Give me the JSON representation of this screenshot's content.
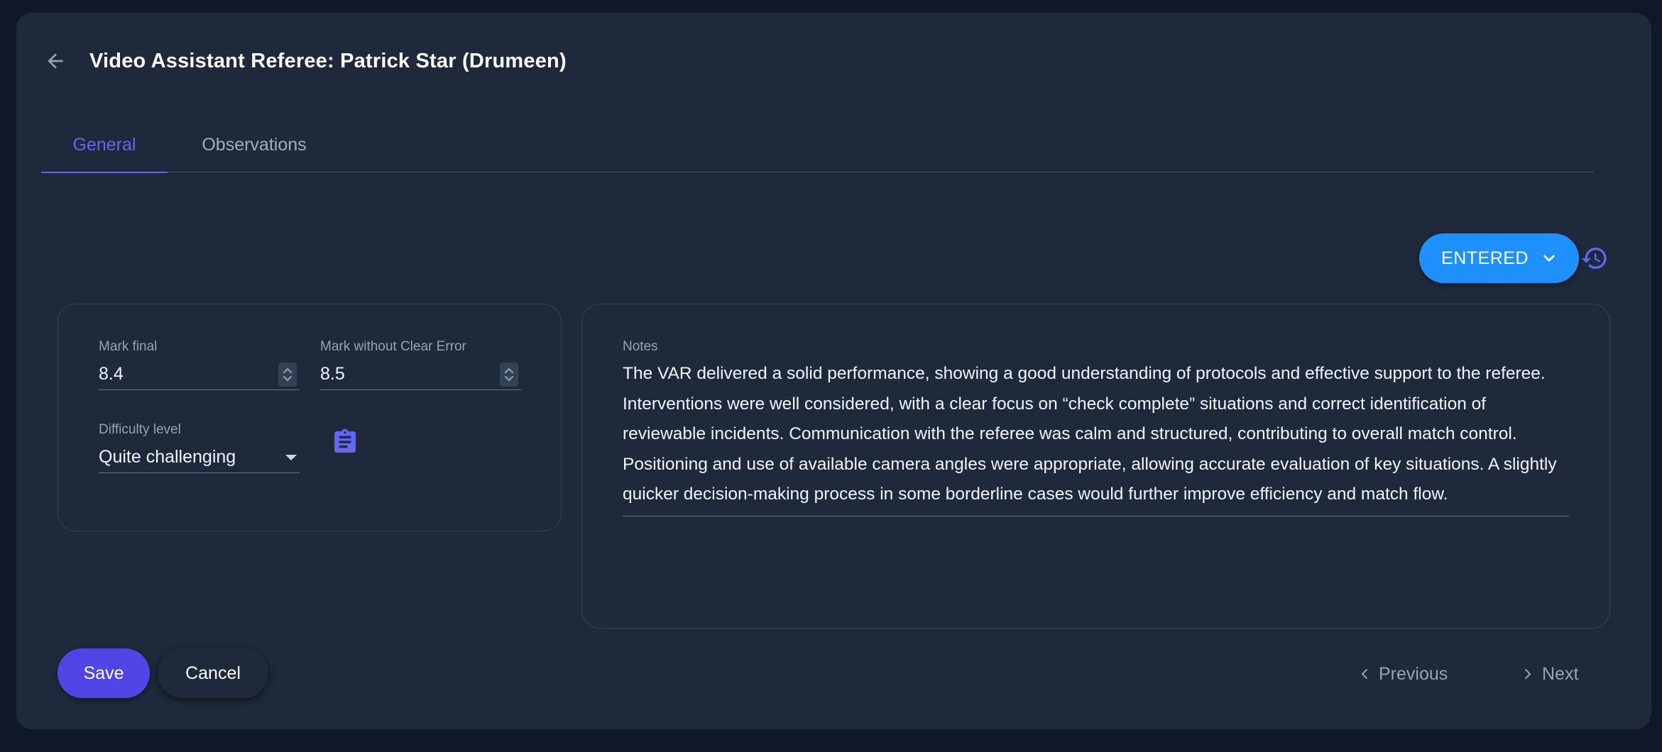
{
  "header": {
    "back_icon": "arrow-left-icon",
    "title": "Video Assistant Referee: Patrick Star (Drumeen)"
  },
  "tabs": [
    {
      "label": "General",
      "active": true
    },
    {
      "label": "Observations",
      "active": false
    }
  ],
  "status": {
    "label": "ENTERED",
    "color": "#1e90ff",
    "dropdown_icon": "chevron-down-icon",
    "history_icon": "history-icon"
  },
  "fields": {
    "mark_final": {
      "label": "Mark final",
      "value": "8.4"
    },
    "mark_without_clear_error": {
      "label": "Mark without Clear Error",
      "value": "8.5"
    },
    "difficulty_level": {
      "label": "Difficulty level",
      "value": "Quite challenging"
    },
    "clipboard_icon": "clipboard-icon"
  },
  "notes": {
    "label": "Notes",
    "text": "The VAR delivered a solid performance, showing a good understanding of protocols and effective support to the referee. Interventions were well considered, with a clear focus on “check complete” situations and correct identification of reviewable incidents. Communication with the referee was calm and structured, contributing to overall match control.\nPositioning and use of available camera angles were appropriate, allowing accurate evaluation of key situations. A slightly quicker decision-making process in some borderline cases would further improve efficiency and match flow."
  },
  "actions": {
    "save_label": "Save",
    "cancel_label": "Cancel",
    "previous_label": "Previous",
    "next_label": "Next"
  },
  "colors": {
    "accent": "#6366f1",
    "save": "#4f46e5",
    "background": "#0f172a",
    "card": "#1e293b"
  }
}
